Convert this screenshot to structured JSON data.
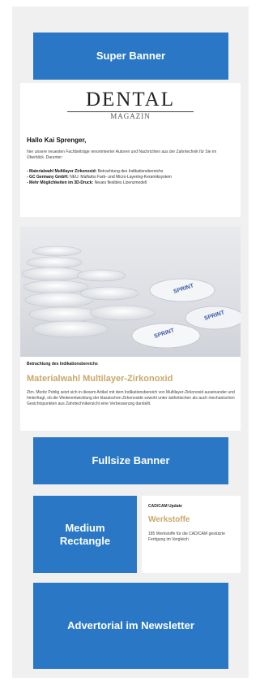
{
  "banners": {
    "super": "Super Banner",
    "fullsize": "Fullsize Banner",
    "medium": "Medium Rectangle",
    "advertorial": "Advertorial im Newsletter"
  },
  "newsletter": {
    "logo_main": "DENTAL",
    "logo_sub": "MAGAZIN",
    "greeting": "Hallo Kai Sprenger,",
    "intro": "hier unsere neuesten Fachbeiträge renommierter Autoren und Nachrichten aus der Zahntechnik für Sie im Überblick. Darunter:",
    "bullets": [
      {
        "title": "- Materialwahl Multilayer Zirkonoxid:",
        "text": " Betrachtung des Indikationsbereichs"
      },
      {
        "title": "- GC Germany GmbH:",
        "text": " NEU: Malfarbs Farb- und Micro-Layering-Keramiksystem"
      },
      {
        "title": "- Mehr Möglichkeiten im 3D-Druck:",
        "text": " Neues flexibles Lizenzmodell"
      }
    ]
  },
  "article": {
    "kicker": "Betrachtung des Indikationsbereichs",
    "headline": "Materialwahl Multilayer-Zirkonoxid",
    "body": "Ztm. Moritz Pohlig setzt sich in diesem Artikel mit dem Indikationsbereich von Multilayer-Zirkonoxid auseinander und hinterfragt, ob die Weiterentwicklung der klassischen Zirkonoxide sowohl unter ästhetischen als auch mechanischen Gesichtspunkten aus Zahntechnikersicht eine Verbesserung darstellt."
  },
  "side_article": {
    "kicker": "CAD/CAM Update",
    "headline": "Werkstoffe",
    "body": "185 Werkstoffe für die CAD/CAM gestützte Fertigung im Vergleich"
  },
  "hero": {
    "disc_label": "SPRINT"
  },
  "colors": {
    "banner": "#2a78c5",
    "headline": "#c9a86a"
  }
}
